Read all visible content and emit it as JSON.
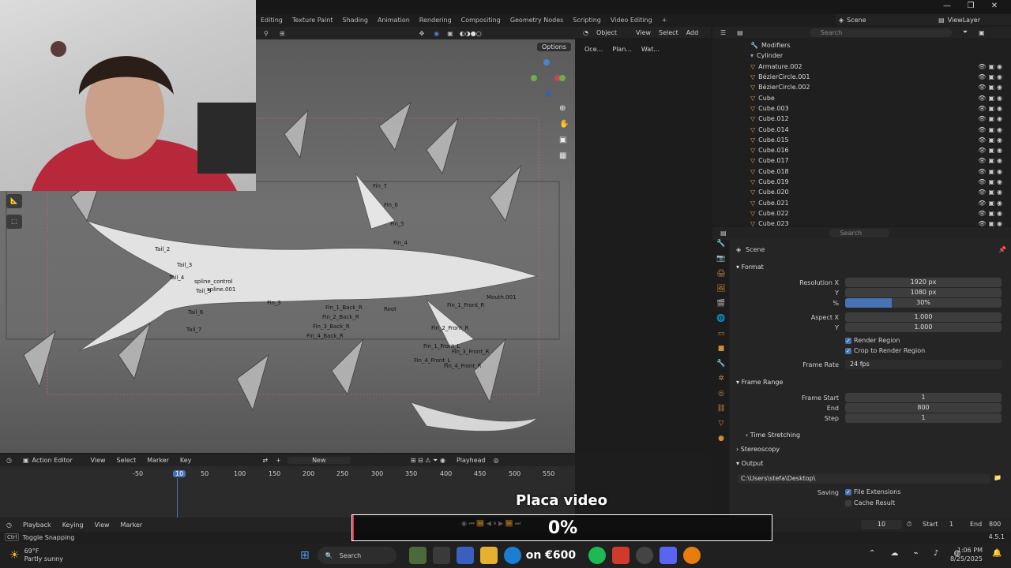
{
  "workspace_tabs": [
    "Editing",
    "Texture Paint",
    "Shading",
    "Animation",
    "Rendering",
    "Compositing",
    "Geometry Nodes",
    "Scripting",
    "Video Editing",
    "+"
  ],
  "top_right": {
    "scene": "Scene",
    "view_layer": "ViewLayer"
  },
  "viewport_header": {
    "mode": "Object",
    "view": "View",
    "select": "Select",
    "add": "Add",
    "options": "Options"
  },
  "mid_header": [
    "Oce...",
    "Plan...",
    "Wat..."
  ],
  "outliner": {
    "search_placeholder": "Search",
    "items": [
      {
        "name": "Modifiers"
      },
      {
        "name": "Cylinder"
      },
      {
        "name": "Armature.002"
      },
      {
        "name": "BézierCircle.001"
      },
      {
        "name": "BézierCircle.002"
      },
      {
        "name": "Cube"
      },
      {
        "name": "Cube.003"
      },
      {
        "name": "Cube.012"
      },
      {
        "name": "Cube.014"
      },
      {
        "name": "Cube.015"
      },
      {
        "name": "Cube.016"
      },
      {
        "name": "Cube.017"
      },
      {
        "name": "Cube.018"
      },
      {
        "name": "Cube.019"
      },
      {
        "name": "Cube.020"
      },
      {
        "name": "Cube.021"
      },
      {
        "name": "Cube.022"
      },
      {
        "name": "Cube.023"
      }
    ]
  },
  "properties": {
    "search_placeholder": "Search",
    "context": "Scene",
    "format_label": "Format",
    "resolution_x_label": "Resolution X",
    "resolution_x": "1920 px",
    "y_label": "Y",
    "resolution_y": "1080 px",
    "percent_label": "%",
    "percent": "30%",
    "percent_fill": 0.3,
    "aspect_x_label": "Aspect X",
    "aspect_x": "1.000",
    "aspect_y": "1.000",
    "render_region": "Render Region",
    "crop_region": "Crop to Render Region",
    "frame_rate_label": "Frame Rate",
    "frame_rate": "24 fps",
    "frame_range_label": "Frame Range",
    "frame_start_label": "Frame Start",
    "frame_start": "1",
    "end_label": "End",
    "frame_end": "800",
    "step_label": "Step",
    "step": "1",
    "time_stretching": "Time Stretching",
    "stereoscopy": "Stereoscopy",
    "output_label": "Output",
    "output_path": "C:\\Users\\stefa\\Desktop\\",
    "saving_label": "Saving",
    "file_extensions": "File Extensions",
    "cache_result": "Cache Result"
  },
  "timeline": {
    "editor": "Action Editor",
    "menus": [
      "View",
      "Select",
      "Marker",
      "Key"
    ],
    "new_button": "New",
    "playhead": "Playhead",
    "ticks": [
      "-50",
      "10",
      "50",
      "100",
      "150",
      "200",
      "250",
      "300",
      "350",
      "400",
      "450",
      "500",
      "550"
    ],
    "current_frame": "10"
  },
  "bottom_bar": {
    "menus": [
      "Playback",
      "Keying",
      "View",
      "Marker"
    ],
    "current_frame": "10",
    "start_label": "Start",
    "start": "1",
    "end_label": "End",
    "end": "800"
  },
  "status": {
    "hint_key": "Ctrl",
    "hint": "Toggle Snapping",
    "version": "4.5.1"
  },
  "overlay": {
    "title": "Placa video",
    "percent": "0%"
  },
  "taskbar": {
    "weather_temp": "69°F",
    "weather_desc": "Partly sunny",
    "search": "Search",
    "promo": "on €600",
    "time": "1:06 PM",
    "date": "8/25/2025"
  },
  "bone_labels": [
    "Fin_7",
    "Fin_6",
    "Fin_5",
    "Fin_4",
    "Tail_2",
    "Tail_3",
    "Tail_4",
    "Tail_5",
    "Tail_6",
    "Tail_7",
    "Root",
    "Fin_3",
    "Mouth.001",
    "Fin_1_Front_R",
    "Fin_2_Front_R",
    "Fin_1_Front_L",
    "Fin_3_Front_R",
    "Fin_4_Front_L",
    "Fin_4_Front_R",
    "Fin_1_Back_R",
    "Fin_2_Back_R",
    "Fin_3_Back_R",
    "Fin_4_Back_R",
    "spline_control",
    "spline.001"
  ],
  "colors": {
    "accent": "#4772b3",
    "bg": "#1d1d1d",
    "panel": "#252525"
  }
}
